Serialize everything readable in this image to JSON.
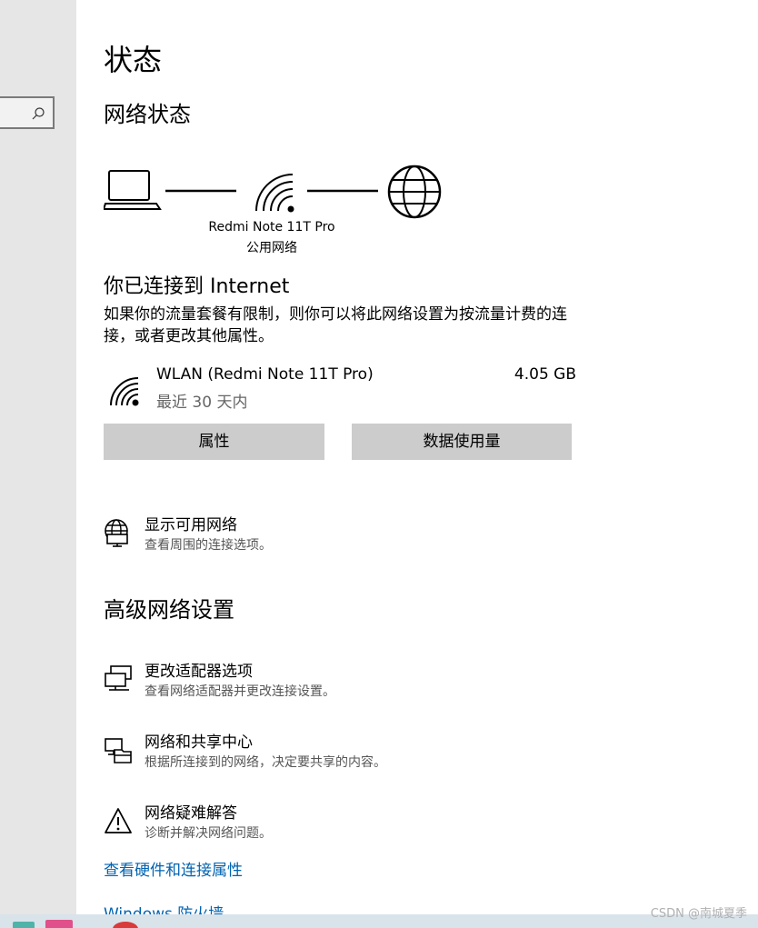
{
  "sidebar": {
    "search": {
      "placeholder": ""
    }
  },
  "page": {
    "title": "状态"
  },
  "network_status": {
    "title": "网络状态",
    "network_name": "Redmi Note 11T Pro",
    "network_type": "公用网络"
  },
  "connection": {
    "title": "你已连接到 Internet",
    "description": "如果你的流量套餐有限制，则你可以将此网络设置为按流量计费的连接，或者更改其他属性。",
    "adapter_name": "WLAN (Redmi Note 11T Pro)",
    "usage_period": "最近 30 天内",
    "usage_amount": "4.05 GB"
  },
  "buttons": {
    "properties": "属性",
    "data_usage": "数据使用量"
  },
  "show_networks": {
    "title": "显示可用网络",
    "desc": "查看周围的连接选项。",
    "icon": "globe-monitor-icon"
  },
  "advanced": {
    "title": "高级网络设置",
    "items": [
      {
        "title": "更改适配器选项",
        "desc": "查看网络适配器并更改连接设置。",
        "icon": "network-adapter-icon"
      },
      {
        "title": "网络和共享中心",
        "desc": "根据所连接到的网络，决定要共享的内容。",
        "icon": "sharing-center-icon"
      },
      {
        "title": "网络疑难解答",
        "desc": "诊断并解决网络问题。",
        "icon": "warning-icon"
      }
    ]
  },
  "links": {
    "hardware_properties": "查看硬件和连接属性",
    "firewall": "Windows 防火墙"
  },
  "watermark": "CSDN @南城夏季",
  "colors": {
    "accent": "#0063b1",
    "sidebar": "#e6e6e6",
    "button": "#cccccc"
  }
}
